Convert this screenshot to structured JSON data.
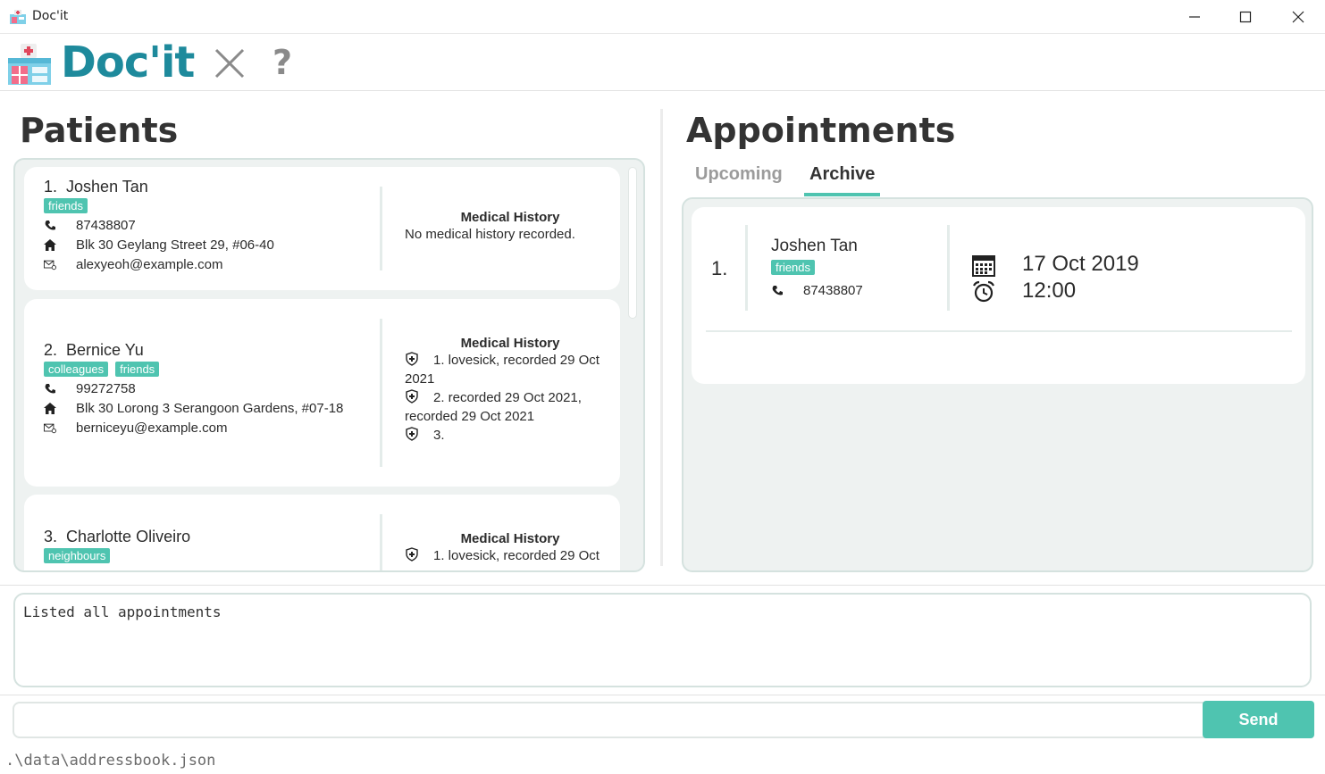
{
  "window": {
    "title": "Doc'it"
  },
  "header": {
    "logo_text": "Doc'it",
    "help_label": "?"
  },
  "patients": {
    "title": "Patients",
    "items": [
      {
        "index": "1.",
        "name": "Joshen Tan",
        "tags": [
          "friends"
        ],
        "phone": "87438807",
        "address": "Blk 30 Geylang Street 29, #06-40",
        "email": "alexyeoh@example.com",
        "medical_history_title": "Medical History",
        "medical_history_empty": "No medical history recorded."
      },
      {
        "index": "2.",
        "name": "Bernice Yu",
        "tags": [
          "colleagues",
          "friends"
        ],
        "phone": "99272758",
        "address": "Blk 30 Lorong 3 Serangoon Gardens, #07-18",
        "email": "berniceyu@example.com",
        "medical_history_title": "Medical History",
        "medical_history": [
          "1. lovesick, recorded 29 Oct 2021",
          "2. recorded 29 Oct 2021, recorded 29 Oct 2021",
          "3."
        ]
      },
      {
        "index": "3.",
        "name": "Charlotte Oliveiro",
        "tags": [
          "neighbours"
        ],
        "medical_history_title": "Medical History",
        "medical_history": [
          "1. lovesick, recorded 29 Oct"
        ]
      }
    ]
  },
  "appointments": {
    "title": "Appointments",
    "tabs": [
      {
        "label": "Upcoming",
        "active": false
      },
      {
        "label": "Archive",
        "active": true
      }
    ],
    "items": [
      {
        "index": "1.",
        "name": "Joshen Tan",
        "tags": [
          "friends"
        ],
        "phone": "87438807",
        "date": "17 Oct 2019",
        "time": "12:00"
      }
    ]
  },
  "result": {
    "text": "Listed all appointments"
  },
  "command": {
    "value": "",
    "placeholder": "",
    "send_label": "Send"
  },
  "status": {
    "file_path": ".\\data\\addressbook.json"
  },
  "colors": {
    "accent": "#4fc4b0",
    "logo": "#1e8a9c",
    "panel_bg": "#eef2f1"
  }
}
